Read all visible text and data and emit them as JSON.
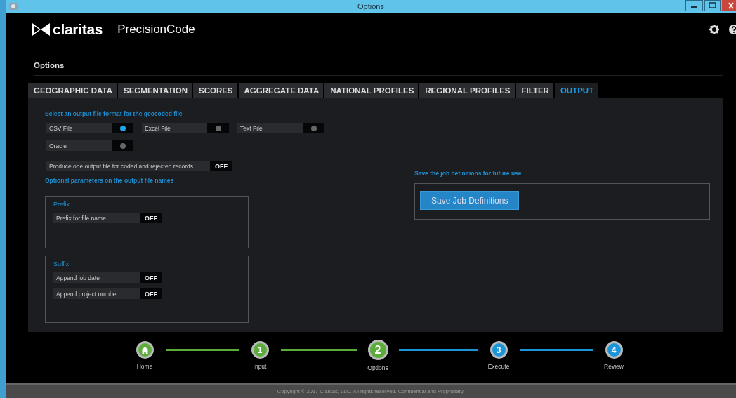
{
  "window": {
    "title": "Options"
  },
  "app": {
    "brand": "claritas",
    "product": "PrecisionCode"
  },
  "page_title": "Options",
  "tabs": [
    {
      "label": "GEOGRAPHIC DATA",
      "selected": false
    },
    {
      "label": "SEGMENTATION",
      "selected": false
    },
    {
      "label": "SCORES",
      "selected": false
    },
    {
      "label": "AGGREGATE DATA",
      "selected": false
    },
    {
      "label": "NATIONAL PROFILES",
      "selected": false
    },
    {
      "label": "REGIONAL PROFILES",
      "selected": false
    },
    {
      "label": "FILTER",
      "selected": false
    },
    {
      "label": "OUTPUT",
      "selected": true
    }
  ],
  "format_section": {
    "heading": "Select an output file format for the geocoded file",
    "options": [
      {
        "label": "CSV File",
        "selected": true
      },
      {
        "label": "Excel File",
        "selected": false
      },
      {
        "label": "Text File",
        "selected": false
      },
      {
        "label": "Oracle",
        "selected": false
      }
    ]
  },
  "single_file": {
    "label": "Produce one output file for coded and rejected records",
    "on": false,
    "state_text": "OFF"
  },
  "name_params": {
    "heading": "Optional parameters on the output file names",
    "groups": [
      {
        "title": "Prefix",
        "settings": [
          {
            "label": "Prefix for file name",
            "on": false,
            "state_text": "OFF"
          }
        ]
      },
      {
        "title": "Suffix",
        "settings": [
          {
            "label": "Append job date",
            "on": false,
            "state_text": "OFF"
          },
          {
            "label": "Append project number",
            "on": false,
            "state_text": "OFF"
          }
        ]
      }
    ]
  },
  "save": {
    "heading": "Save the job definitions for future use",
    "button": "Save Job Definitions"
  },
  "steps": [
    {
      "label": "Home",
      "kind": "home",
      "selected": false
    },
    {
      "label": "Input",
      "kind": "number",
      "number": "1",
      "selected": false
    },
    {
      "label": "Options",
      "kind": "number",
      "number": "2",
      "selected": true
    },
    {
      "label": "Execute",
      "kind": "number",
      "number": "3",
      "selected": false
    },
    {
      "label": "Review",
      "kind": "number",
      "number": "4",
      "selected": false
    }
  ],
  "footer": "Copyright © 2017 Claritas, LLC. All rights reserved. Confidential and Proprietary."
}
